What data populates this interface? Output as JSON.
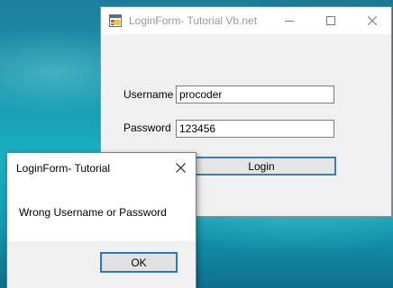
{
  "main_window": {
    "title": "LoginForm- Tutorial Vb.net",
    "username_label": "Username",
    "username_value": "procoder",
    "password_label": "Password",
    "password_value": "123456",
    "login_button": "Login"
  },
  "message_box": {
    "title": "LoginForm- Tutorial",
    "message": "Wrong Username or Password",
    "ok_button": "OK"
  },
  "icons": {
    "app_icon": "form-icon",
    "minimize": "minimize-icon",
    "maximize": "maximize-icon",
    "close": "close-icon"
  }
}
